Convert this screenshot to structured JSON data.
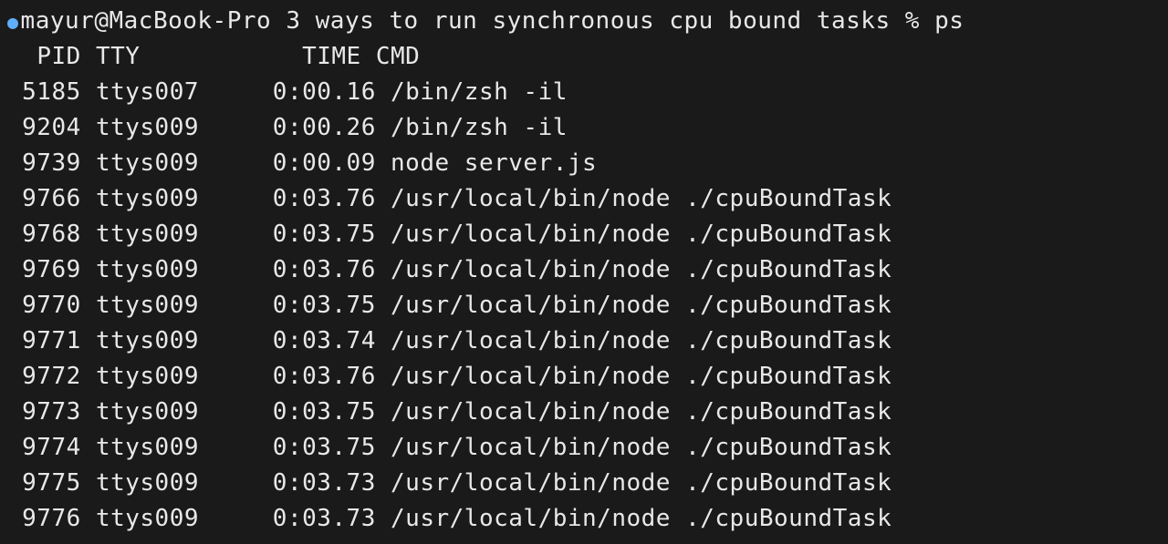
{
  "prompt": {
    "user": "mayur",
    "host": "MacBook-Pro",
    "cwd": "3 ways to run synchronous cpu bound tasks",
    "symbol": "%",
    "command": "ps"
  },
  "header": {
    "pid": "PID",
    "tty": "TTY",
    "time": "TIME",
    "cmd": "CMD"
  },
  "processes": [
    {
      "pid": "5185",
      "tty": "ttys007",
      "time": "0:00.16",
      "cmd": "/bin/zsh -il"
    },
    {
      "pid": "9204",
      "tty": "ttys009",
      "time": "0:00.26",
      "cmd": "/bin/zsh -il"
    },
    {
      "pid": "9739",
      "tty": "ttys009",
      "time": "0:00.09",
      "cmd": "node server.js"
    },
    {
      "pid": "9766",
      "tty": "ttys009",
      "time": "0:03.76",
      "cmd": "/usr/local/bin/node ./cpuBoundTask"
    },
    {
      "pid": "9768",
      "tty": "ttys009",
      "time": "0:03.75",
      "cmd": "/usr/local/bin/node ./cpuBoundTask"
    },
    {
      "pid": "9769",
      "tty": "ttys009",
      "time": "0:03.76",
      "cmd": "/usr/local/bin/node ./cpuBoundTask"
    },
    {
      "pid": "9770",
      "tty": "ttys009",
      "time": "0:03.75",
      "cmd": "/usr/local/bin/node ./cpuBoundTask"
    },
    {
      "pid": "9771",
      "tty": "ttys009",
      "time": "0:03.74",
      "cmd": "/usr/local/bin/node ./cpuBoundTask"
    },
    {
      "pid": "9772",
      "tty": "ttys009",
      "time": "0:03.76",
      "cmd": "/usr/local/bin/node ./cpuBoundTask"
    },
    {
      "pid": "9773",
      "tty": "ttys009",
      "time": "0:03.75",
      "cmd": "/usr/local/bin/node ./cpuBoundTask"
    },
    {
      "pid": "9774",
      "tty": "ttys009",
      "time": "0:03.75",
      "cmd": "/usr/local/bin/node ./cpuBoundTask"
    },
    {
      "pid": "9775",
      "tty": "ttys009",
      "time": "0:03.73",
      "cmd": "/usr/local/bin/node ./cpuBoundTask"
    },
    {
      "pid": "9776",
      "tty": "ttys009",
      "time": "0:03.73",
      "cmd": "/usr/local/bin/node ./cpuBoundTask"
    }
  ]
}
